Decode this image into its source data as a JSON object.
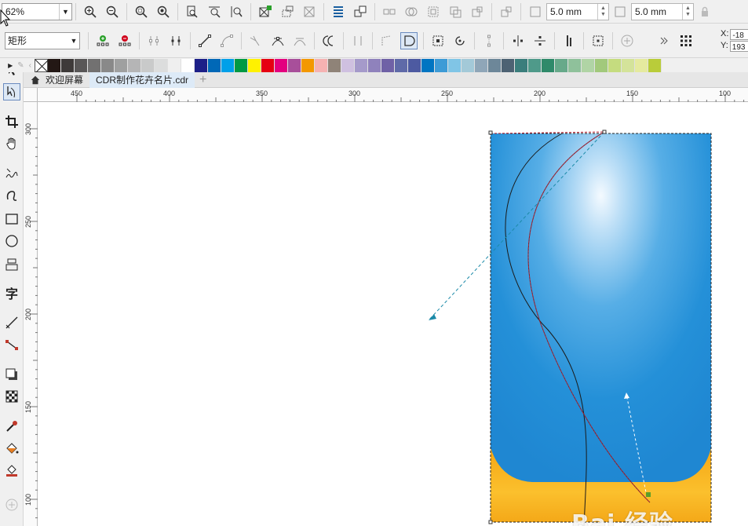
{
  "toolbar": {
    "zoom_value": "62%",
    "nudge_width": "5.0 mm",
    "nudge_height": "5.0 mm",
    "x_label": "X:",
    "y_label": "Y:",
    "x_value": "-18",
    "y_value": "193"
  },
  "property_bar": {
    "shape_type": "矩形"
  },
  "palette": {
    "colors": [
      "#231815",
      "#3e3a39",
      "#595757",
      "#727171",
      "#898989",
      "#9fa0a0",
      "#b5b5b6",
      "#c9caca",
      "#dcdddd",
      "#efefef",
      "#ffffff",
      "#1d2088",
      "#0068b7",
      "#00a0e9",
      "#009944",
      "#fff100",
      "#e60012",
      "#e4007f",
      "#a84f9a",
      "#f39800",
      "#f5b2b2",
      "#8f8378",
      "#cfc0e0",
      "#a59aca",
      "#8f82bc",
      "#6f61a6",
      "#5f6aa8",
      "#4d5aa1",
      "#0075c2",
      "#3d9bd6",
      "#80c5e6",
      "#a3c9d8",
      "#8fa6b8",
      "#6d8799",
      "#4d6273",
      "#3b7e7c",
      "#4f9a8a",
      "#2f8a6a",
      "#67a98a",
      "#8fc19b",
      "#b0d4a5",
      "#a2c97c",
      "#c5dc7f",
      "#d4e39a",
      "#e5ea9f",
      "#b9cc3a"
    ]
  },
  "tabs": [
    {
      "label": "欢迎屏幕"
    },
    {
      "label": "CDR制作花卉名片.cdr"
    }
  ],
  "rulers": {
    "horizontal_ticks": [
      "450",
      "400",
      "350",
      "300",
      "250",
      "200",
      "150",
      "100"
    ],
    "vertical_ticks": [
      "300",
      "250",
      "200",
      "150",
      "100"
    ]
  },
  "watermark": {
    "text": "Bai 经验"
  },
  "colors": {
    "doc_blue_light": "#e8f4fd",
    "doc_blue": "#2490d8",
    "doc_orange": "#f5a614",
    "doc_orange_light": "#fbc02d",
    "outline_red": "#c0283a",
    "vector_teal": "#1b8aa8"
  }
}
